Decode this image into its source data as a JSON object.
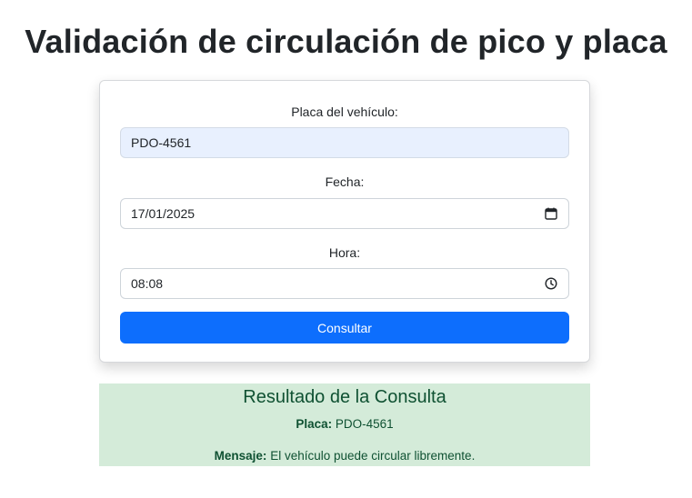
{
  "page": {
    "title": "Validación de circulación de pico y placa"
  },
  "form": {
    "plate_label": "Placa del vehículo:",
    "plate_value": "PDO-4561",
    "date_label": "Fecha:",
    "date_value": "17/01/2025",
    "date_icon": "calendar-icon",
    "time_label": "Hora:",
    "time_value": "08:08",
    "time_icon": "clock-icon",
    "submit_label": "Consultar"
  },
  "result": {
    "title": "Resultado de la Consulta",
    "plate_key": "Placa:",
    "plate_value": "PDO-4561",
    "message_key": "Mensaje:",
    "message_value": "El vehículo puede circular libremente."
  },
  "colors": {
    "primary_button": "#0d6efd",
    "autofill_background": "#e8f0fe",
    "result_background": "#d4ebd9",
    "result_text": "#0f5132"
  }
}
